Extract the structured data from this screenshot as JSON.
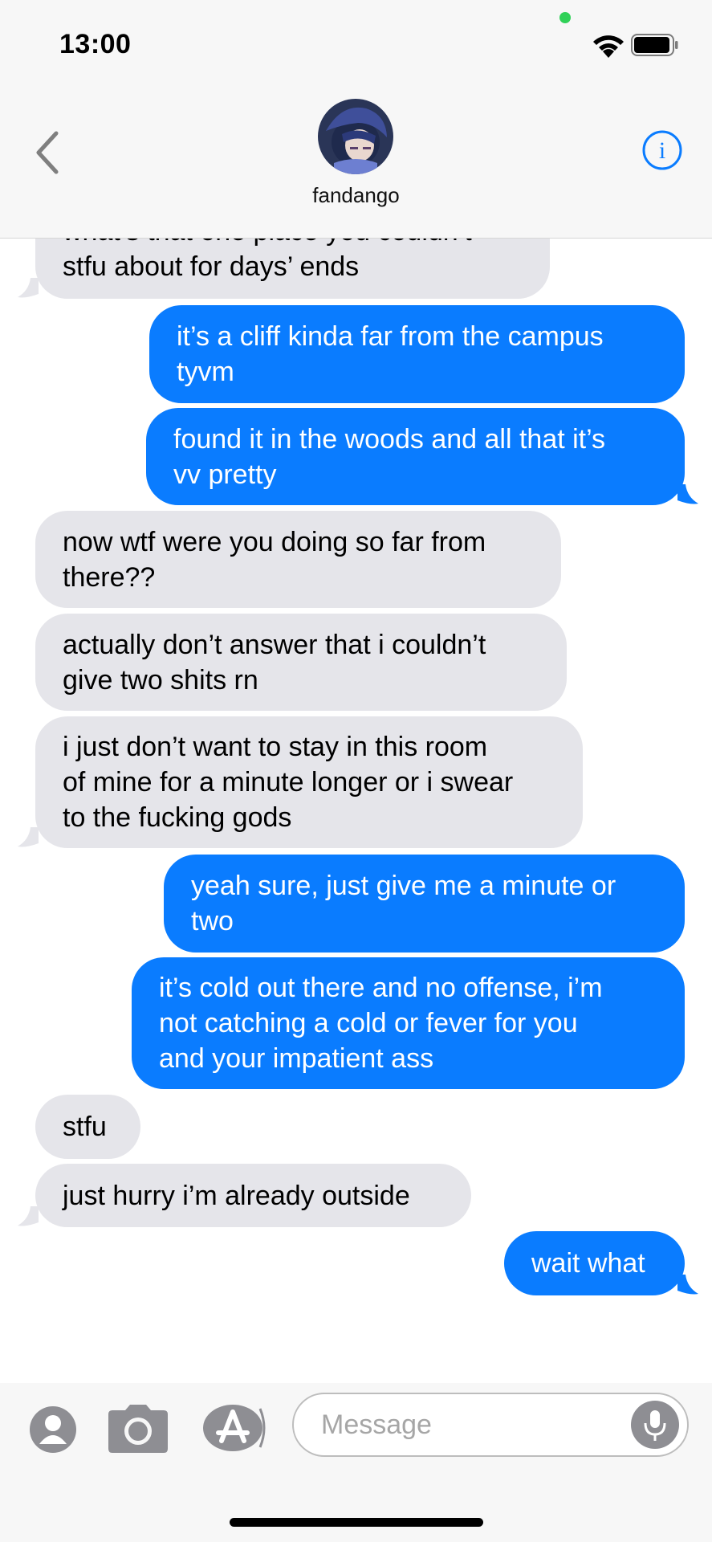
{
  "status_bar": {
    "time": "13:00"
  },
  "header": {
    "contact_name": "fandango"
  },
  "messages": [
    {
      "text": "what’s that one place you couldn’t\nstfu about for days’ ends",
      "direction": "incoming"
    },
    {
      "text": "it’s a cliff kinda far from the campus\ntyvm",
      "direction": "outgoing"
    },
    {
      "text": "found it in the woods and all that it’s\nvv pretty",
      "direction": "outgoing"
    },
    {
      "text": "now wtf were you doing so far from\nthere??",
      "direction": "incoming"
    },
    {
      "text": "actually don’t answer that i couldn’t\ngive two shits rn",
      "direction": "incoming"
    },
    {
      "text": "i just don’t want to stay in this room\nof mine for a minute longer or i swear\nto the fucking gods",
      "direction": "incoming"
    },
    {
      "text": "yeah sure, just give me a minute or\ntwo",
      "direction": "outgoing"
    },
    {
      "text": "it’s cold out there and no offense, i’m\nnot catching a cold or fever for you\nand your impatient ass",
      "direction": "outgoing"
    },
    {
      "text": "stfu",
      "direction": "incoming"
    },
    {
      "text": "just hurry i’m already outside",
      "direction": "incoming"
    },
    {
      "text": "wait what",
      "direction": "outgoing"
    }
  ],
  "input": {
    "placeholder": "Message"
  },
  "colors": {
    "outgoing_bubble": "#0a7cff",
    "incoming_bubble": "#e5e5ea",
    "accent": "#0a7cff"
  }
}
